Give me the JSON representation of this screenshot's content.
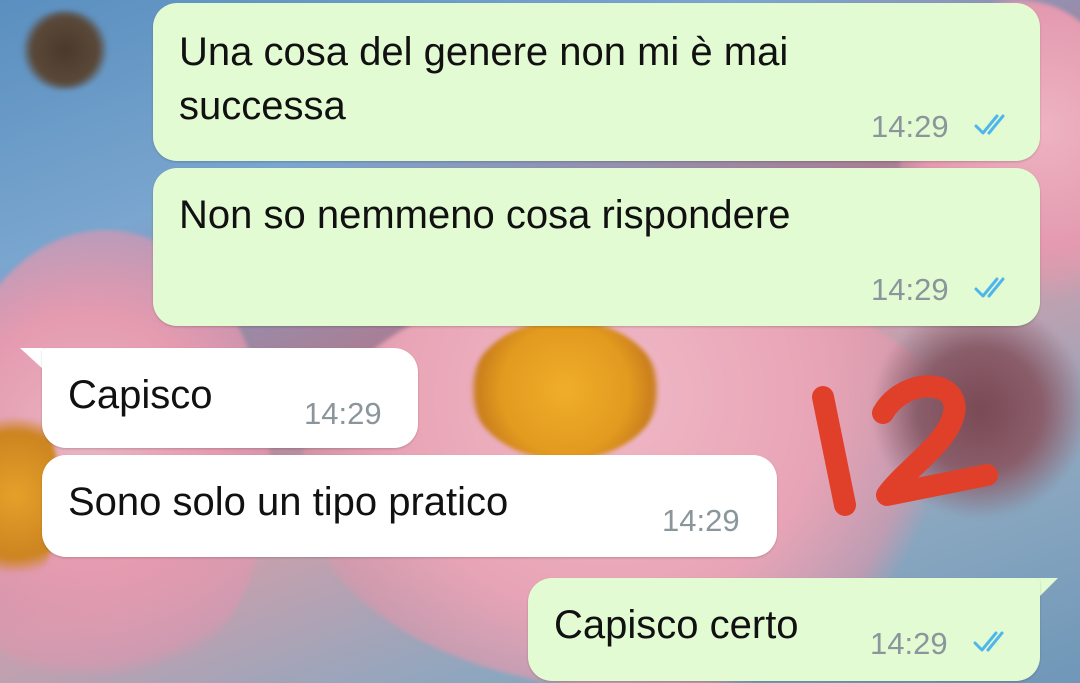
{
  "chat": {
    "messages": [
      {
        "text": "Una cosa del genere non mi è mai\nsuccessa",
        "time": "14:29",
        "direction": "outgoing",
        "status": "read"
      },
      {
        "text": "Non so nemmeno cosa rispondere",
        "time": "14:29",
        "direction": "outgoing",
        "status": "read"
      },
      {
        "text": "Capisco",
        "time": "14:29",
        "direction": "incoming"
      },
      {
        "text": "Sono solo un tipo pratico",
        "time": "14:29",
        "direction": "incoming"
      },
      {
        "text": "Capisco certo",
        "time": "14:29",
        "direction": "outgoing",
        "status": "read"
      }
    ]
  },
  "annotation": {
    "handwritten_number": "12",
    "color": "#e0402a"
  },
  "colors": {
    "outgoing_bubble": "#e3fbd3",
    "incoming_bubble": "#ffffff",
    "read_ticks": "#4fb6ec",
    "timestamp": "#8a969b"
  },
  "icons": {
    "read_receipt": "double-check-icon"
  }
}
